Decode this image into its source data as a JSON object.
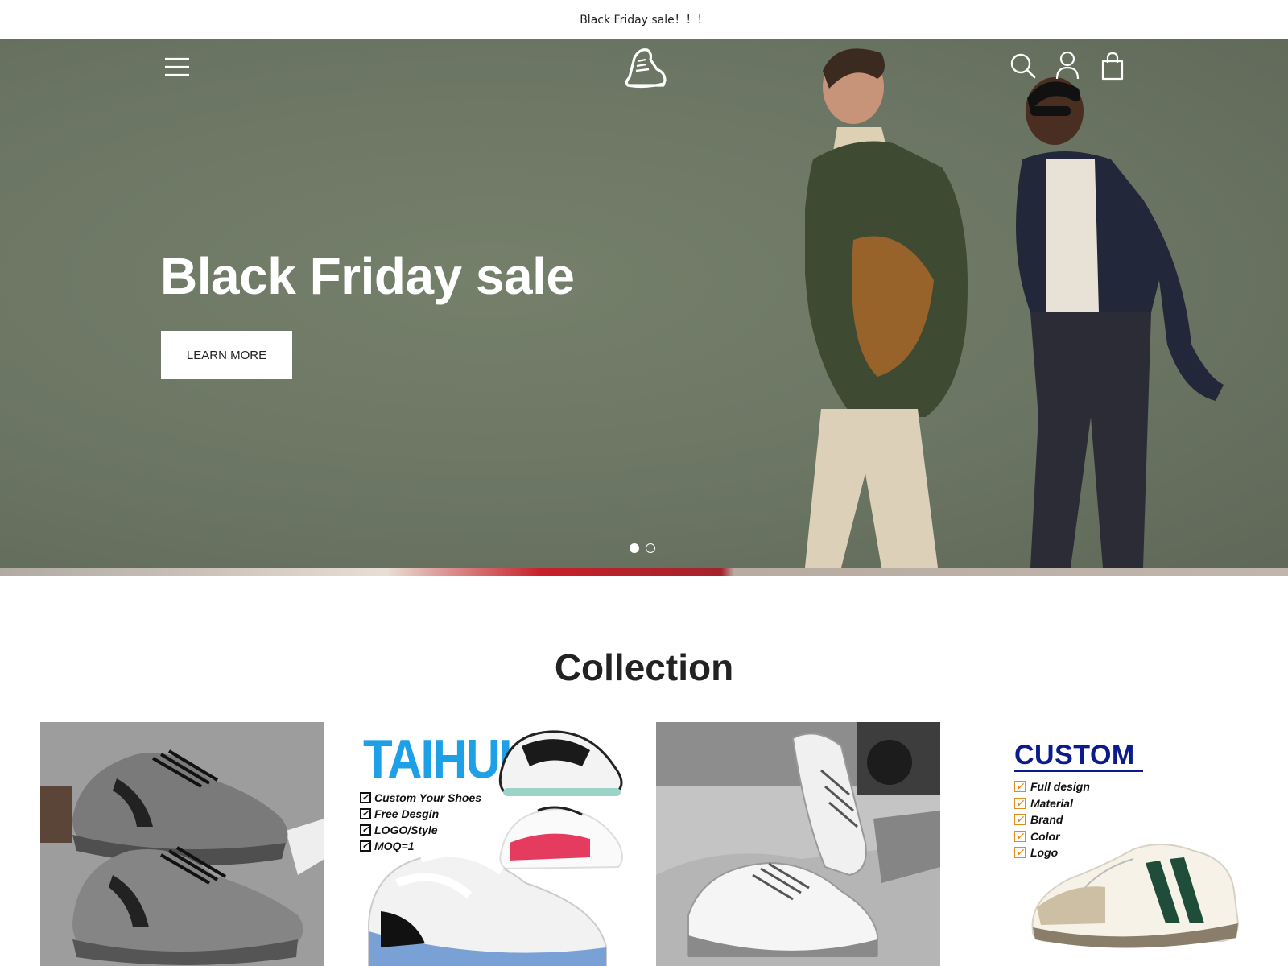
{
  "announcement": {
    "text": "Black Friday sale！！！"
  },
  "header": {
    "icons": [
      "menu-icon",
      "sneaker-logo",
      "search-icon",
      "account-icon",
      "cart-icon"
    ]
  },
  "hero": {
    "title": "Black Friday sale",
    "button_label": "LEARN MORE",
    "slides": 2,
    "active_slide": 1,
    "background_color": "#6b7563"
  },
  "collection": {
    "title": "Collection",
    "cards": [
      {
        "id": "card-gray-sneakers"
      },
      {
        "id": "card-taihui",
        "brand": "TAIHUI",
        "features": [
          "Custom Your Shoes",
          "Free Desgin",
          "LOGO/Style",
          "MOQ=1"
        ]
      },
      {
        "id": "card-white-sneakers"
      },
      {
        "id": "card-custom",
        "title": "CUSTOM",
        "features": [
          "Full design",
          "Material",
          "Brand",
          "Color",
          "Logo"
        ]
      }
    ]
  }
}
